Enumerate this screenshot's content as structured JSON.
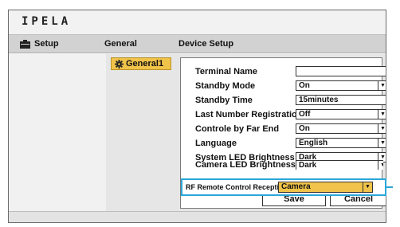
{
  "header": {
    "logo_text": "IPELA"
  },
  "tabs": {
    "setup_label": "Setup",
    "general_label": "General",
    "device_setup_label": "Device Setup"
  },
  "nav": {
    "general_item_label": "General1"
  },
  "form": {
    "terminal_name": {
      "label": "Terminal Name",
      "value": ""
    },
    "standby_mode": {
      "label": "Standby Mode",
      "value": "On"
    },
    "standby_time": {
      "label": "Standby Time",
      "value": "15minutes"
    },
    "last_number_registration": {
      "label": "Last Number Registration",
      "value": "Off"
    },
    "controle_by_far_end": {
      "label": "Controle by Far End",
      "value": "On"
    },
    "language": {
      "label": "Language",
      "value": "English"
    },
    "system_led_brightness": {
      "label": "System LED Brightness",
      "value": "Dark"
    },
    "camera_led_brightness": {
      "label": "Camera LED Brightness",
      "value": "Dark"
    },
    "rf_remote_control_reception": {
      "label": "RF Remote Control Reception",
      "value": "Camera"
    }
  },
  "buttons": {
    "save_label": "Save",
    "cancel_label": "Cancel"
  },
  "colors": {
    "highlight": "#2aa7d8",
    "selected": "#f0c34a",
    "tab_bar": "#d2d2d2",
    "pane": "#e6e6e6"
  },
  "icons": {
    "setup": "toolbox-icon",
    "general": "gear-icon",
    "dropdown": "chevron-down-icon"
  }
}
